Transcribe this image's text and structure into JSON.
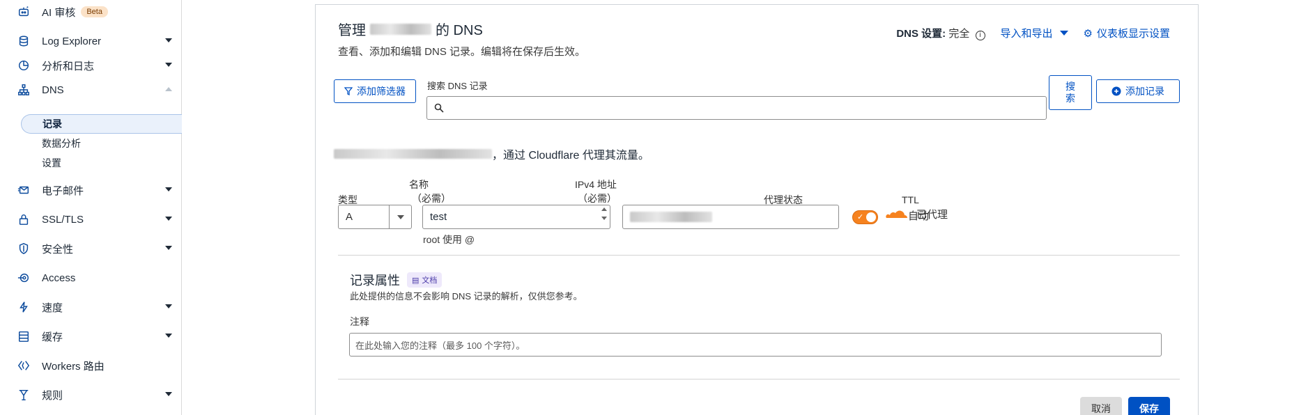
{
  "sidebar": {
    "items": [
      {
        "label": "AI 审核",
        "badge": "Beta",
        "icon": "ai-audit-icon"
      },
      {
        "label": "Log Explorer",
        "icon": "log-explorer-icon"
      },
      {
        "label": "分析和日志",
        "icon": "analytics-icon"
      },
      {
        "label": "DNS",
        "icon": "dns-icon"
      },
      {
        "label": "电子邮件",
        "icon": "email-icon"
      },
      {
        "label": "SSL/TLS",
        "icon": "lock-icon"
      },
      {
        "label": "安全性",
        "icon": "shield-icon"
      },
      {
        "label": "Access",
        "icon": "access-icon"
      },
      {
        "label": "速度",
        "icon": "lightning-icon"
      },
      {
        "label": "缓存",
        "icon": "cache-icon"
      },
      {
        "label": "Workers 路由",
        "icon": "workers-icon"
      },
      {
        "label": "规则",
        "icon": "rules-icon"
      }
    ],
    "dns_sub": [
      "记录",
      "数据分析",
      "设置"
    ]
  },
  "header": {
    "title_prefix": "管理",
    "title_suffix": "的 DNS",
    "subtitle": "查看、添加和编辑 DNS 记录。编辑将在保存后生效。",
    "dns_setting_label": "DNS 设置:",
    "dns_setting_value": "完全",
    "import_export": "导入和导出",
    "dashboard_display": "仪表板显示设置"
  },
  "toolbar": {
    "add_filter": "添加筛选器",
    "search_label": "搜索 DNS 记录",
    "search_placeholder": "",
    "search_button": "搜索",
    "add_record": "添加记录"
  },
  "proxy_note": "，通过 Cloudflare 代理其流量。",
  "form": {
    "type_label": "类型",
    "type_value": "A",
    "name_label": "名称",
    "name_required": "（必需）",
    "name_value": "test",
    "name_helper": "root 使用 @",
    "ipv4_label": "IPv4 地址",
    "ipv4_required": "（必需）",
    "proxy_label": "代理状态",
    "proxy_value": "已代理",
    "ttl_label": "TTL",
    "ttl_value": "自动"
  },
  "attributes": {
    "title": "记录属性",
    "doc_badge": "文档",
    "description": "此处提供的信息不会影响 DNS 记录的解析，仅供您参考。",
    "comment_label": "注释",
    "comment_placeholder": "在此处输入您的注释（最多 100 个字符）。"
  },
  "actions": {
    "cancel": "取消",
    "save": "保存"
  },
  "colors": {
    "accent": "#0051c3",
    "proxy_orange": "#f6821f"
  }
}
